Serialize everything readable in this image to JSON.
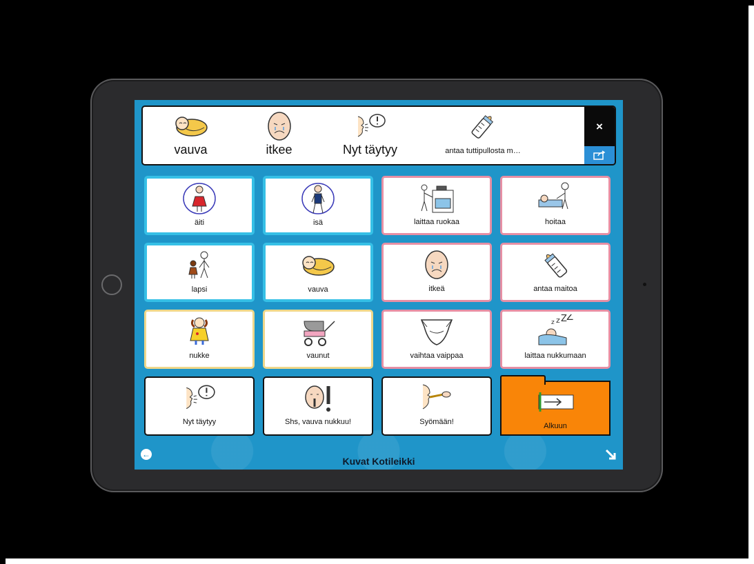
{
  "message_bar": {
    "words": [
      {
        "label": "vauva",
        "icon": "baby-icon"
      },
      {
        "label": "itkee",
        "icon": "crying-face-icon"
      },
      {
        "label": "Nyt täytyy",
        "icon": "speaking-exclamation-icon"
      },
      {
        "label": "antaa tuttipullosta m…",
        "icon": "baby-bottle-icon"
      }
    ],
    "close_label": "×",
    "share_icon": "share-icon"
  },
  "grid": {
    "cells": [
      {
        "label": "äiti",
        "icon": "mother-icon",
        "border": "blue"
      },
      {
        "label": "isä",
        "icon": "father-icon",
        "border": "blue"
      },
      {
        "label": "laittaa ruokaa",
        "icon": "cooking-icon",
        "border": "pink"
      },
      {
        "label": "hoitaa",
        "icon": "caring-icon",
        "border": "pink"
      },
      {
        "label": "lapsi",
        "icon": "child-icon",
        "border": "blue"
      },
      {
        "label": "vauva",
        "icon": "baby-icon",
        "border": "blue"
      },
      {
        "label": "itkeä",
        "icon": "crying-face-icon",
        "border": "pink"
      },
      {
        "label": "antaa maitoa",
        "icon": "baby-bottle-icon",
        "border": "pink"
      },
      {
        "label": "nukke",
        "icon": "doll-icon",
        "border": "yellow"
      },
      {
        "label": "vaunut",
        "icon": "pram-icon",
        "border": "yellow"
      },
      {
        "label": "vaihtaa vaippaa",
        "icon": "diaper-icon",
        "border": "pink"
      },
      {
        "label": "laittaa nukkumaan",
        "icon": "sleeping-baby-icon",
        "border": "pink"
      },
      {
        "label": "Nyt täytyy",
        "icon": "speaking-exclamation-icon",
        "border": "black"
      },
      {
        "label": "Shs, vauva nukkuu!",
        "icon": "shush-icon",
        "border": "black"
      },
      {
        "label": "Syömään!",
        "icon": "eating-icon",
        "border": "black"
      },
      {
        "label": "Alkuun",
        "icon": "home-arrow-icon",
        "border": "folder"
      }
    ]
  },
  "footer": {
    "title": "Kuvat Kotileikki",
    "back_label": "←"
  },
  "colors": {
    "screen_bg": "#1f95c9",
    "blue_border": "#36c0e6",
    "pink_border": "#e68fa4",
    "yellow_border": "#efd78a",
    "folder_orange": "#f98508",
    "share_blue": "#2b8fd6"
  }
}
